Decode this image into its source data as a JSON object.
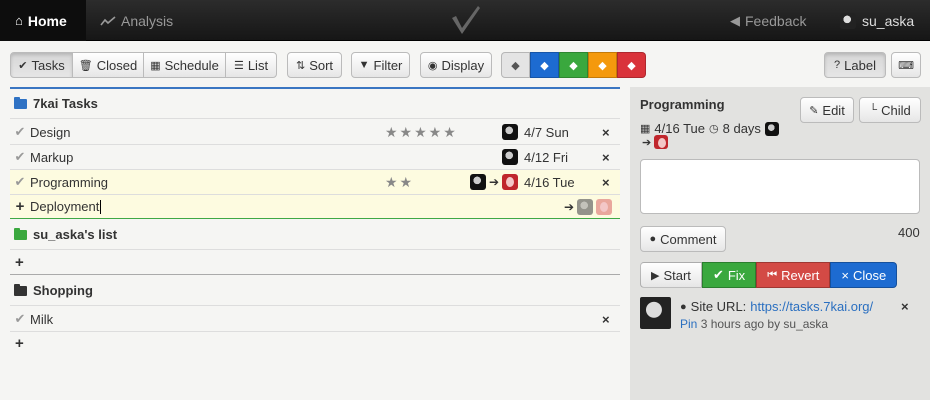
{
  "nav": {
    "home": "Home",
    "analysis": "Analysis",
    "feedback": "Feedback",
    "user": "su_aska"
  },
  "toolbar": {
    "tabs": [
      "Tasks",
      "Closed",
      "Schedule",
      "List"
    ],
    "sort": "Sort",
    "filter": "Filter",
    "display": "Display",
    "tag_colors": [
      "#e4e4e4",
      "#1d6bd1",
      "#3aa83e",
      "#f4990d",
      "#d9333a"
    ],
    "label": "Label"
  },
  "lists": [
    {
      "title": "7kai Tasks",
      "folder_color": "#2f72c4",
      "tasks": [
        {
          "name": "Design",
          "stars": "★★★★★",
          "date": "4/7 Sun"
        },
        {
          "name": "Markup",
          "stars": "",
          "date": "4/12 Fri"
        },
        {
          "name": "Programming",
          "stars": "★★",
          "date": "4/16 Tue"
        }
      ],
      "new_task": "Deployment"
    },
    {
      "title": "su_aska's list",
      "folder_color": "#3aa83e",
      "tasks": []
    },
    {
      "title": "Shopping",
      "folder_color": "#333333",
      "tasks": [
        {
          "name": "Milk"
        }
      ]
    }
  ],
  "detail": {
    "title": "Programming",
    "edit": "Edit",
    "child": "Child",
    "due": "4/16 Tue",
    "duration": "8 days",
    "comment_btn": "Comment",
    "char_count": "400",
    "actions": {
      "start": "Start",
      "fix": "Fix",
      "revert": "Revert",
      "close": "Close"
    },
    "comment": {
      "label": "Site URL:",
      "url": "https://tasks.7kai.org/",
      "pin": "Pin",
      "meta": "3 hours ago by su_aska"
    }
  }
}
